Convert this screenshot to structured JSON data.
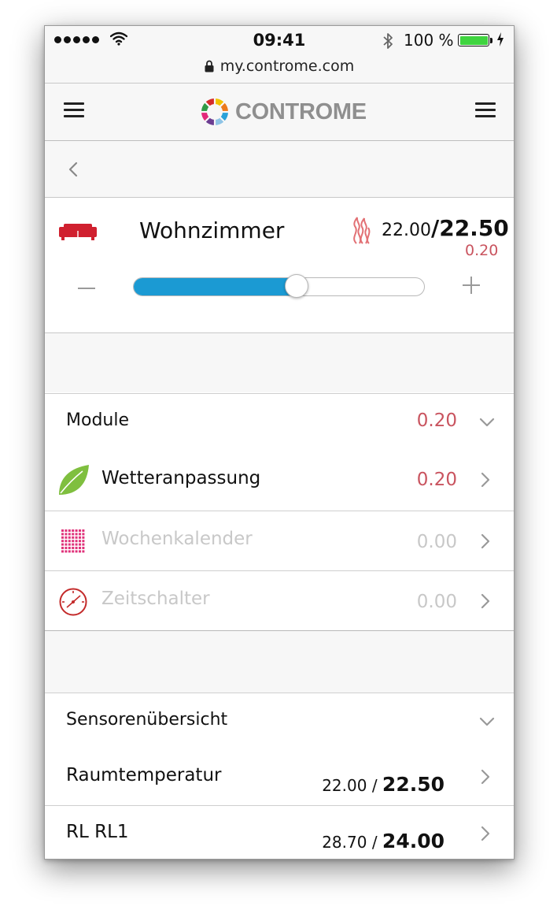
{
  "status_bar": {
    "time": "09:41",
    "battery": "100 %",
    "url": "my.controme.com"
  },
  "header": {
    "brand": "CONTROME"
  },
  "room": {
    "name": "Wohnzimmer",
    "current_temp": "22.00",
    "separator": "/",
    "target_temp": "22.50",
    "offset": "0.20",
    "slider_fraction": 0.56
  },
  "modules": {
    "title": "Module",
    "total": "0.20",
    "items": [
      {
        "label": "Wetteranpassung",
        "value": "0.20",
        "active": true,
        "icon": "leaf-icon"
      },
      {
        "label": "Wochenkalender",
        "value": "0.00",
        "active": false,
        "icon": "calendar-grid-icon"
      },
      {
        "label": "Zeitschalter",
        "value": "0.00",
        "active": false,
        "icon": "timer-icon"
      }
    ]
  },
  "sensors": {
    "title": "Sensorenübersicht",
    "items": [
      {
        "label": "Raumtemperatur",
        "current": "22.00",
        "separator": " / ",
        "target": "22.50"
      },
      {
        "label": "RL RL1",
        "current": "28.70",
        "separator": " / ",
        "target": "24.00"
      }
    ]
  },
  "colors": {
    "accent_blue": "#1b9ad3",
    "offset_red": "#c9545f",
    "sofa_red": "#d0202f",
    "leaf_green": "#7fbf3f"
  }
}
